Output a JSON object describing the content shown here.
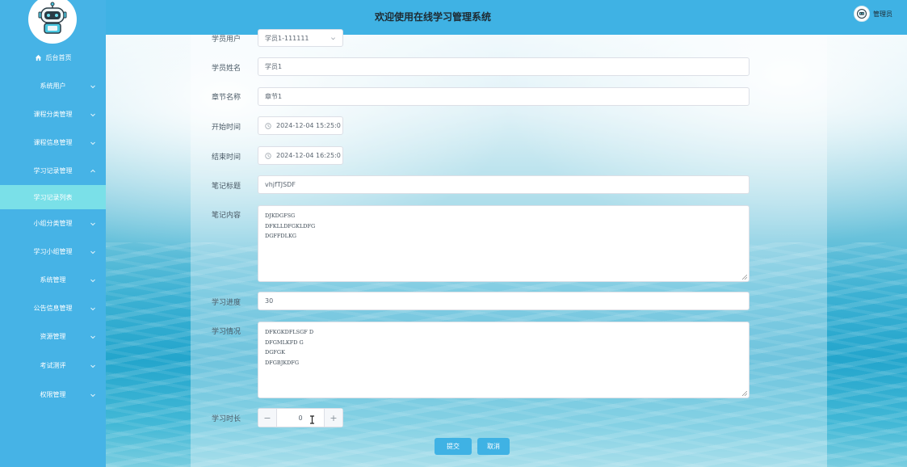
{
  "header": {
    "title": "欢迎使用在线学习管理系统",
    "user_name": "管理员"
  },
  "sidebar": {
    "items": [
      {
        "label": "后台首页",
        "icon": "home-icon"
      },
      {
        "label": "系统用户"
      },
      {
        "label": "课程分类管理"
      },
      {
        "label": "课程信息管理"
      },
      {
        "label": "学习记录管理"
      },
      {
        "label": "学习记录列表"
      },
      {
        "label": "小组分类管理"
      },
      {
        "label": "学习小组管理"
      },
      {
        "label": "系统管理"
      },
      {
        "label": "公告信息管理"
      },
      {
        "label": "资源管理"
      },
      {
        "label": "考试测评"
      },
      {
        "label": "权限管理"
      }
    ]
  },
  "form": {
    "student_user": {
      "label": "学员用户",
      "value": "学员1-111111"
    },
    "student_name": {
      "label": "学员姓名",
      "value": "学员1"
    },
    "chapter_name": {
      "label": "章节名称",
      "value": "章节1"
    },
    "start_time": {
      "label": "开始时间",
      "value": "2024-12-04 15:25:0"
    },
    "end_time": {
      "label": "结束时间",
      "value": "2024-12-04 16:25:0"
    },
    "note_title": {
      "label": "笔记标题",
      "value": "vhjfTJSDF"
    },
    "note_content": {
      "label": "笔记内容",
      "lines": [
        "DJKDGFSG",
        "DFKLLDFGKLDFG",
        "DGFFDLKG"
      ]
    },
    "progress": {
      "label": "学习进度",
      "value": "30"
    },
    "status": {
      "label": "学习情况",
      "lines": [
        "DFKGKDFLSGF D",
        "DFGMLKFD G",
        "DGFGK",
        "DFGBJKDFG"
      ]
    },
    "duration": {
      "label": "学习时长",
      "value": "0",
      "minus": "−",
      "plus": "+"
    }
  },
  "actions": {
    "submit": "提交",
    "cancel": "取消"
  },
  "colors": {
    "sidebar": "#46b3e6",
    "header": "#3fb2e4",
    "active_item": "#7ae0e8",
    "primary_button": "#3fb2e4"
  }
}
